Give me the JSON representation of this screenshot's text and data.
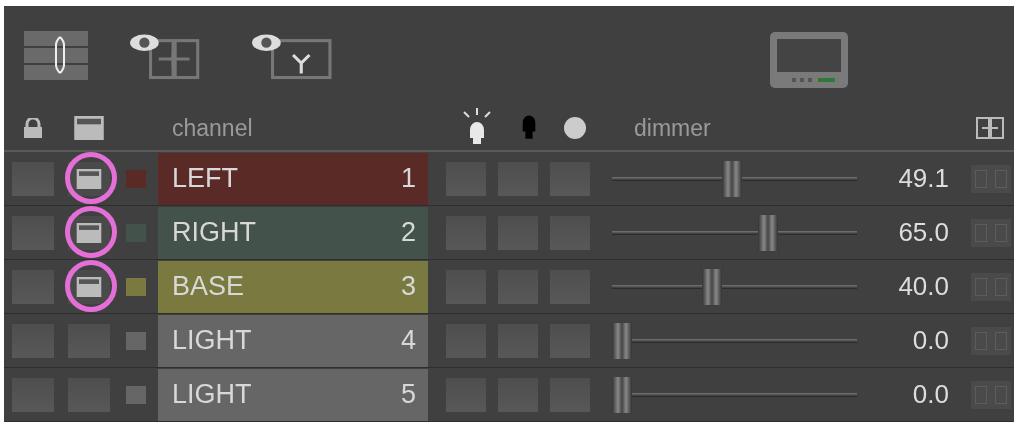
{
  "header": {
    "channel_label": "channel",
    "dimmer_label": "dimmer"
  },
  "channels": [
    {
      "name": "LEFT",
      "number": "1",
      "color": "#5a2b26",
      "selected": true,
      "highlighted": true,
      "level": 0.491,
      "reading": "49.1"
    },
    {
      "name": "RIGHT",
      "number": "2",
      "color": "#44524c",
      "selected": true,
      "highlighted": true,
      "level": 0.65,
      "reading": "65.0"
    },
    {
      "name": "BASE",
      "number": "3",
      "color": "#7a7a40",
      "selected": true,
      "highlighted": true,
      "level": 0.4,
      "reading": "40.0"
    },
    {
      "name": "LIGHT",
      "number": "4",
      "color": "#666666",
      "selected": false,
      "highlighted": false,
      "level": 0,
      "reading": "0.0"
    },
    {
      "name": "LIGHT",
      "number": "5",
      "color": "#666666",
      "selected": false,
      "highlighted": false,
      "level": 0,
      "reading": "0.0"
    }
  ]
}
